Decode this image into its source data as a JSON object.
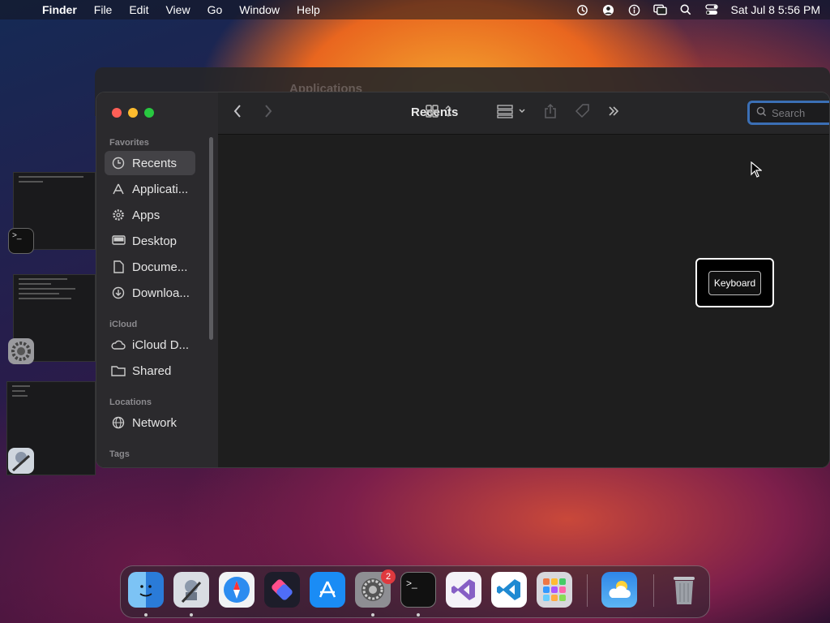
{
  "menubar": {
    "app": "Finder",
    "items": [
      "File",
      "Edit",
      "View",
      "Go",
      "Window",
      "Help"
    ],
    "datetime": "Sat Jul 8  5:56 PM",
    "status_icons": [
      "time-machine-icon",
      "user-icon",
      "accessibility-icon",
      "screen-mirroring-icon",
      "spotlight-icon",
      "control-center-icon"
    ]
  },
  "background_window": {
    "title": "Applications"
  },
  "finder": {
    "title": "Recents",
    "search": {
      "placeholder": "Search",
      "value": ""
    },
    "sidebar": {
      "favorites_label": "Favorites",
      "favorites": [
        {
          "label": "Recents",
          "icon": "clock-icon",
          "active": true
        },
        {
          "label": "Applicati...",
          "icon": "applications-icon"
        },
        {
          "label": "Apps",
          "icon": "gear-icon"
        },
        {
          "label": "Desktop",
          "icon": "desktop-icon"
        },
        {
          "label": "Docume...",
          "icon": "document-icon"
        },
        {
          "label": "Downloa...",
          "icon": "download-icon"
        }
      ],
      "icloud_label": "iCloud",
      "icloud": [
        {
          "label": "iCloud D...",
          "icon": "cloud-icon"
        },
        {
          "label": "Shared",
          "icon": "shared-folder-icon"
        }
      ],
      "locations_label": "Locations",
      "locations": [
        {
          "label": "Network",
          "icon": "globe-icon"
        }
      ],
      "tags_label": "Tags"
    }
  },
  "overlay": {
    "keyboard_label": "Keyboard"
  },
  "dock": {
    "apps": [
      "Finder",
      "Automator",
      "Safari",
      "Shortcuts",
      "App Store",
      "System Settings",
      "Terminal",
      "Visual Studio",
      "Visual Studio Code",
      "Launchpad",
      "Weather",
      "Trash"
    ],
    "settings_badge": "2"
  }
}
